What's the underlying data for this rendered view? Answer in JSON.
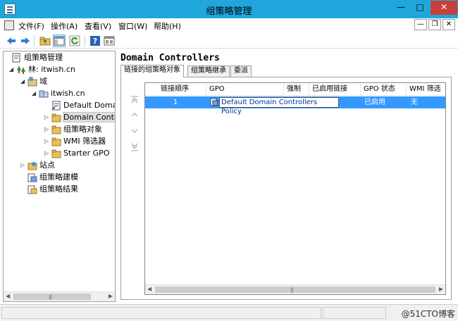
{
  "window": {
    "title": "组策略管理",
    "min_glyph": "—",
    "max_glyph": "□",
    "close_glyph": "✕"
  },
  "menu": {
    "items": [
      "文件(F)",
      "操作(A)",
      "查看(V)",
      "窗口(W)",
      "帮助(H)"
    ],
    "mdi_min": "—",
    "mdi_restore": "❐",
    "mdi_close": "✕"
  },
  "toolbar": {
    "buttons": [
      "back-icon",
      "forward-icon",
      "folder-up-icon",
      "show-pane-icon",
      "refresh-icon",
      "help-icon",
      "properties-icon"
    ]
  },
  "tree": {
    "root": "组策略管理",
    "forest": "林: itwish.cn",
    "domains": "域",
    "domain": "itwish.cn",
    "default_policy": "Default Domai",
    "domain_controllers": "Domain Contro",
    "gpo_objects": "组策略对象",
    "wmi_filters": "WMI 筛选器",
    "starter_gpo": "Starter GPO",
    "sites": "站点",
    "modeling": "组策略建模",
    "results": "组策略结果"
  },
  "details": {
    "title": "Domain Controllers",
    "tabs": [
      "链接的组策略对象",
      "组策略继承",
      "委派"
    ],
    "columns": [
      "链接顺序",
      "GPO",
      "强制",
      "已启用链接",
      "GPO 状态",
      "WMI 筛选"
    ],
    "rows": [
      {
        "order": "1",
        "gpo": "Default Domain Controllers Policy",
        "enforced": "",
        "link_enabled": "",
        "status": "已启用",
        "wmi": "无"
      }
    ]
  },
  "statusbar": {
    "watermark": "@51CTO博客"
  },
  "colors": {
    "titlebar": "#1fa7dc",
    "selection": "#3399ff",
    "close": "#c7403a"
  }
}
